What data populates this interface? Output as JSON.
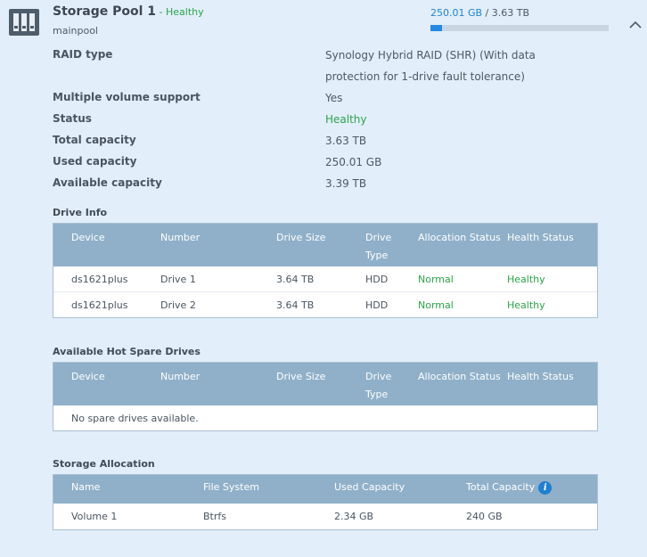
{
  "pool": {
    "title": "Storage Pool 1",
    "status_sep": " - ",
    "status": "Healthy",
    "subtitle": "mainpool",
    "used": "250.01 GB",
    "usage_sep": " / ",
    "total": "3.63 TB",
    "usage_fraction": 0.067
  },
  "properties": [
    {
      "label": "RAID type",
      "value": "Synology Hybrid RAID (SHR) (With data protection for 1-drive fault tolerance)"
    },
    {
      "label": "Multiple volume support",
      "value": "Yes"
    },
    {
      "label": "Status",
      "value": "Healthy"
    },
    {
      "label": "Total capacity",
      "value": "3.63 TB"
    },
    {
      "label": "Used capacity",
      "value": "250.01 GB"
    },
    {
      "label": "Available capacity",
      "value": "3.39 TB"
    }
  ],
  "drive_info": {
    "title": "Drive Info",
    "headers": [
      "Device",
      "Number",
      "Drive Size",
      "Drive Type",
      "Allocation Status",
      "Health Status"
    ],
    "rows": [
      [
        "ds1621plus",
        "Drive 1",
        "3.64 TB",
        "HDD",
        "Normal",
        "Healthy"
      ],
      [
        "ds1621plus",
        "Drive 2",
        "3.64 TB",
        "HDD",
        "Normal",
        "Healthy"
      ]
    ]
  },
  "hot_spare": {
    "title": "Available Hot Spare Drives",
    "headers": [
      "Device",
      "Number",
      "Drive Size",
      "Drive Type",
      "Allocation Status",
      "Health Status"
    ],
    "empty_text": "No spare drives available."
  },
  "allocation": {
    "title": "Storage Allocation",
    "headers": [
      "Name",
      "File System",
      "Used Capacity",
      "Total Capacity"
    ],
    "info_glyph": "i",
    "rows": [
      [
        "Volume 1",
        "Btrfs",
        "2.34 GB",
        "240 GB"
      ]
    ]
  },
  "colors": {
    "healthy": "#2ba44a",
    "accent": "#2389e2",
    "table_header": "#90b0c9",
    "background": "#e2eefa"
  },
  "icons": {
    "pool": "storage-pool-icon",
    "collapse": "chevron-up-icon",
    "info": "info-icon"
  }
}
